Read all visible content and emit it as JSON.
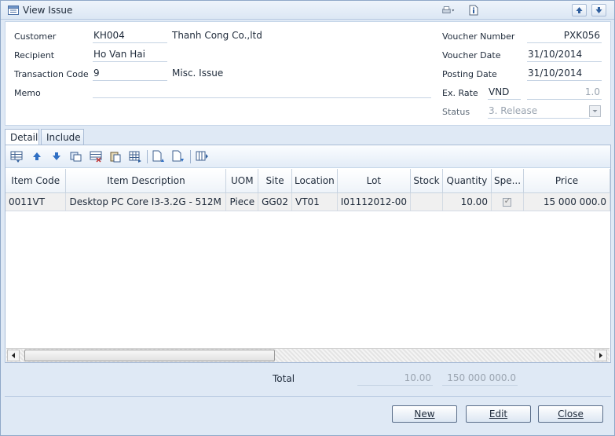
{
  "window": {
    "title": "View Issue",
    "title_icon": "window-icon"
  },
  "titlebar_actions": {
    "print_icon": "printer-icon",
    "info_icon": "document-info-icon",
    "prev_icon": "nav-up-icon",
    "next_icon": "nav-down-icon"
  },
  "header": {
    "customer_label": "Customer",
    "customer_code": "KH004",
    "customer_name": "Thanh Cong Co.,ltd",
    "recipient_label": "Recipient",
    "recipient": "Ho Van Hai",
    "transaction_label": "Transaction Code",
    "transaction_code": "9",
    "transaction_name": "Misc. Issue",
    "memo_label": "Memo",
    "memo": "",
    "voucher_number_label": "Voucher Number",
    "voucher_number": "PXK056",
    "voucher_date_label": "Voucher Date",
    "voucher_date": "31/10/2014",
    "posting_date_label": "Posting Date",
    "posting_date": "31/10/2014",
    "ex_rate_label": "Ex. Rate",
    "currency": "VND",
    "ex_rate": "1.0",
    "status_label": "Status",
    "status": "3. Release"
  },
  "tabs": [
    {
      "label": "Detail"
    },
    {
      "label": "Include"
    }
  ],
  "grid": {
    "columns": [
      "Item Code",
      "Item Description",
      "UOM",
      "Site",
      "Location",
      "Lot",
      "Stock",
      "Quantity",
      "Spe...",
      "Price"
    ],
    "rows": [
      {
        "item_code": "0011VT",
        "description": "Desktop PC Core I3-3.2G - 512M",
        "uom": "Piece",
        "site": "GG02",
        "location": "VT01",
        "lot": "I01112012-00",
        "stock": "",
        "quantity": "10.00",
        "special": true,
        "price": "15 000 000.0"
      }
    ]
  },
  "totals": {
    "label": "Total",
    "quantity": "10.00",
    "amount": "150 000 000.0"
  },
  "buttons": {
    "new": "New",
    "edit": "Edit",
    "close": "Close"
  }
}
